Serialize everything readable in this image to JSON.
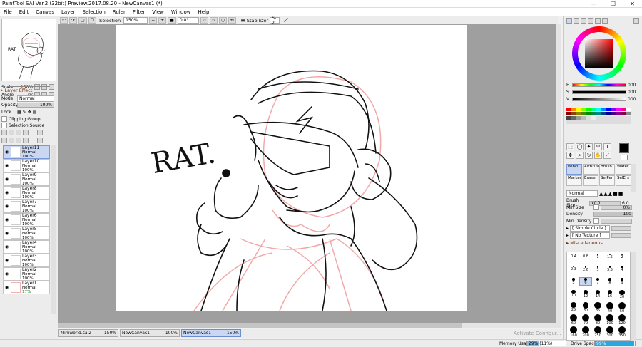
{
  "window": {
    "title": "PaintTool SAI Ver.2 (32bit) Preview.2017.08.20 - NewCanvas1 (*)",
    "controls": [
      "—",
      "☐",
      "✕"
    ]
  },
  "menu": [
    "File",
    "Edit",
    "Canvas",
    "Layer",
    "Selection",
    "Ruler",
    "Filter",
    "View",
    "Window",
    "Help"
  ],
  "toolbar": {
    "selection_label": "Selection",
    "zoom": "150%",
    "angle": "0.0°",
    "stabilizer_label": "Stabilizer",
    "stabilizer_value": "S-2"
  },
  "navigator": {
    "scale_label": "Scale",
    "scale_value": "150%",
    "angle_label": "Angle",
    "angle_value": "0°"
  },
  "layer_effect": {
    "header": "Layer Effect",
    "mode_label": "Mode",
    "mode_value": "Normal",
    "opacity_label": "Opacity",
    "opacity_value": "100%",
    "lock_label": "Lock",
    "clipping_label": "Clipping Group",
    "selection_source_label": "Selection Source"
  },
  "layers": [
    {
      "name": "Layer11",
      "mode": "Normal",
      "opacity": "100%",
      "selected": true
    },
    {
      "name": "Layer10",
      "mode": "Normal",
      "opacity": "100%"
    },
    {
      "name": "Layer9",
      "mode": "Normal",
      "opacity": "100%"
    },
    {
      "name": "Layer8",
      "mode": "Normal",
      "opacity": "100%"
    },
    {
      "name": "Layer7",
      "mode": "Normal",
      "opacity": "100%"
    },
    {
      "name": "Layer6",
      "mode": "Normal",
      "opacity": "100%"
    },
    {
      "name": "Layer5",
      "mode": "Normal",
      "opacity": "100%"
    },
    {
      "name": "Layer4",
      "mode": "Normal",
      "opacity": "100%"
    },
    {
      "name": "Layer3",
      "mode": "Normal",
      "opacity": "100%"
    },
    {
      "name": "Layer2",
      "mode": "Normal",
      "opacity": "100%"
    },
    {
      "name": "Layer1",
      "mode": "Normal",
      "opacity": "17%"
    }
  ],
  "canvas_text": "RAT.",
  "tabs": [
    {
      "name": "Miniworld.sai2",
      "zoom": "150%"
    },
    {
      "name": "NewCanvas1",
      "zoom": "100%"
    },
    {
      "name": "NewCanvas1",
      "zoom": "150%",
      "active": true
    }
  ],
  "status": {
    "memory_label": "Memory Usage",
    "memory_value": "29% (11%)",
    "drive_label": "Drive Space",
    "drive_value": "99%",
    "watermark": "Activate Configur..."
  },
  "color": {
    "h_label": "H",
    "h_value": "000",
    "s_label": "S",
    "s_value": "000",
    "v_label": "V",
    "v_value": "000",
    "current": "#000000"
  },
  "brush": {
    "tools": [
      "Pencil",
      "AirBrush",
      "Brush",
      "Water",
      "Marker",
      "Eraser",
      "SelPen",
      "SelErs"
    ],
    "mode": "Normal",
    "size_label": "Brush Size",
    "size_mult": "x0.1",
    "size_value": "6.0",
    "min_size_label": "Min Size",
    "min_size_value": "0%",
    "density_label": "Density",
    "density_value": "100",
    "min_density_label": "Min Density",
    "texture1": "[ Simple Circle ]",
    "texture2": "[ No Texture ]",
    "misc_label": "Miscellaneous"
  },
  "brush_sizes": [
    "0.4",
    "0.8",
    "1",
    "1.5",
    "2",
    "2.3",
    "2.6",
    "3",
    "3.5",
    "4",
    "5",
    "6",
    "7",
    "8",
    "9",
    "10",
    "12",
    "14",
    "16",
    "20",
    "25",
    "30",
    "35",
    "40",
    "50",
    "60",
    "70",
    "80",
    "100",
    "120",
    "160",
    "200",
    "250",
    "300",
    "350"
  ]
}
